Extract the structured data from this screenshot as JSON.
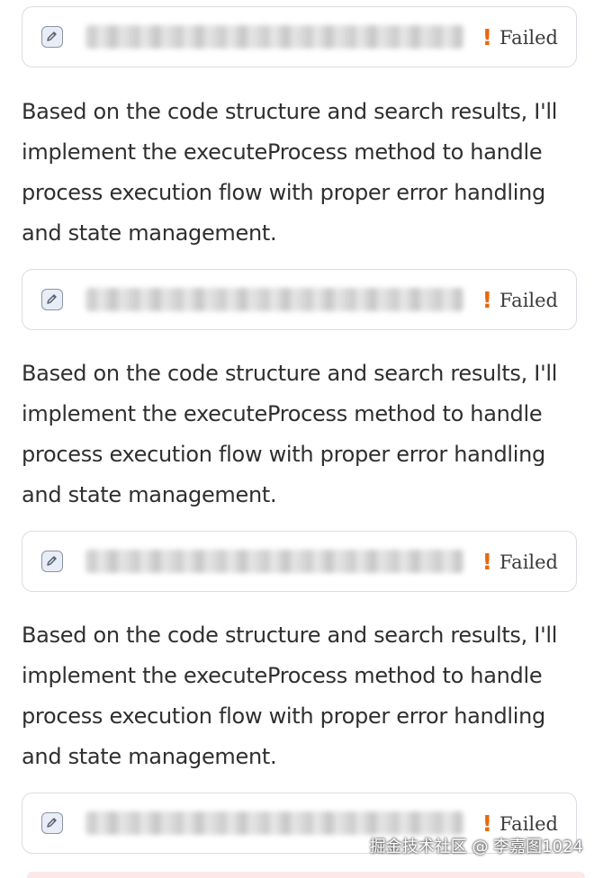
{
  "blocks": [
    {
      "tool": {
        "icon": "edit-icon",
        "path_label": "",
        "status_icon": "exclamation-icon",
        "status_symbol": "!",
        "status_text": "Failed"
      },
      "message": "Based on the code structure and search results, I'll implement the executeProcess method to handle process execution flow with proper error handling and state management."
    },
    {
      "tool": {
        "icon": "edit-icon",
        "path_label": "",
        "status_icon": "exclamation-icon",
        "status_symbol": "!",
        "status_text": "Failed"
      },
      "message": "Based on the code structure and search results, I'll implement the executeProcess method to handle process execution flow with proper error handling and state management."
    },
    {
      "tool": {
        "icon": "edit-icon",
        "path_label": "",
        "status_icon": "exclamation-icon",
        "status_symbol": "!",
        "status_text": "Failed"
      },
      "message": "Based on the code structure and search results, I'll implement the executeProcess method to handle process execution flow with proper error handling and state management."
    },
    {
      "tool": {
        "icon": "edit-icon",
        "path_label": "",
        "status_icon": "exclamation-icon",
        "status_symbol": "!",
        "status_text": "Failed"
      }
    }
  ],
  "watermark": "掘金技术社区 @ 李嘉图1024",
  "colors": {
    "failed_accent": "#e8680e",
    "card_border": "#d9dde3",
    "text": "#2f2f2f"
  }
}
